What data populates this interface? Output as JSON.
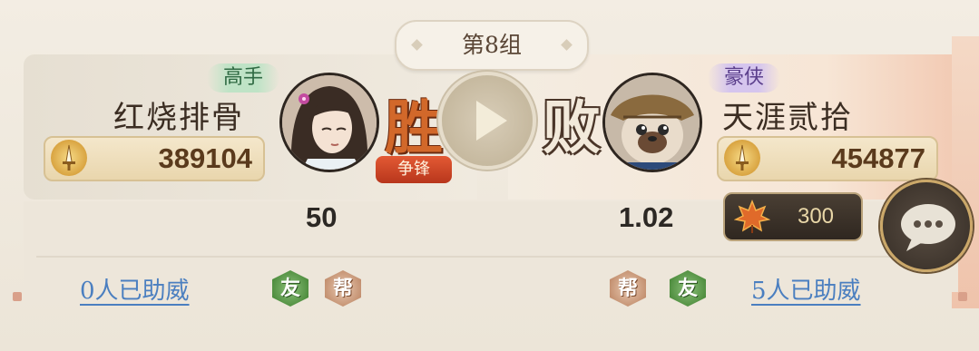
{
  "group": {
    "title": "第8组"
  },
  "left_player": {
    "rank": "高手",
    "name": "红烧排骨",
    "power": "389104",
    "result": "胜",
    "badge": "争锋",
    "score": "50",
    "cheer": "0人已助威",
    "tags": [
      "友",
      "帮"
    ]
  },
  "right_player": {
    "rank": "豪侠",
    "name": "天涯贰拾",
    "power": "454877",
    "result": "败",
    "score": "1.02",
    "bet_amount": "300",
    "cheer": "5人已助威",
    "tags": [
      "帮",
      "友"
    ]
  },
  "icons": {
    "power": "sword-icon",
    "play": "play-icon",
    "bet": "maple-leaf-icon",
    "chat": "chat-bubble-icon"
  },
  "colors": {
    "win": "#d2682a",
    "contend": "#c9431f",
    "link": "#4b7fc0",
    "friend": "#4e8d3e",
    "guild": "#c39070"
  }
}
